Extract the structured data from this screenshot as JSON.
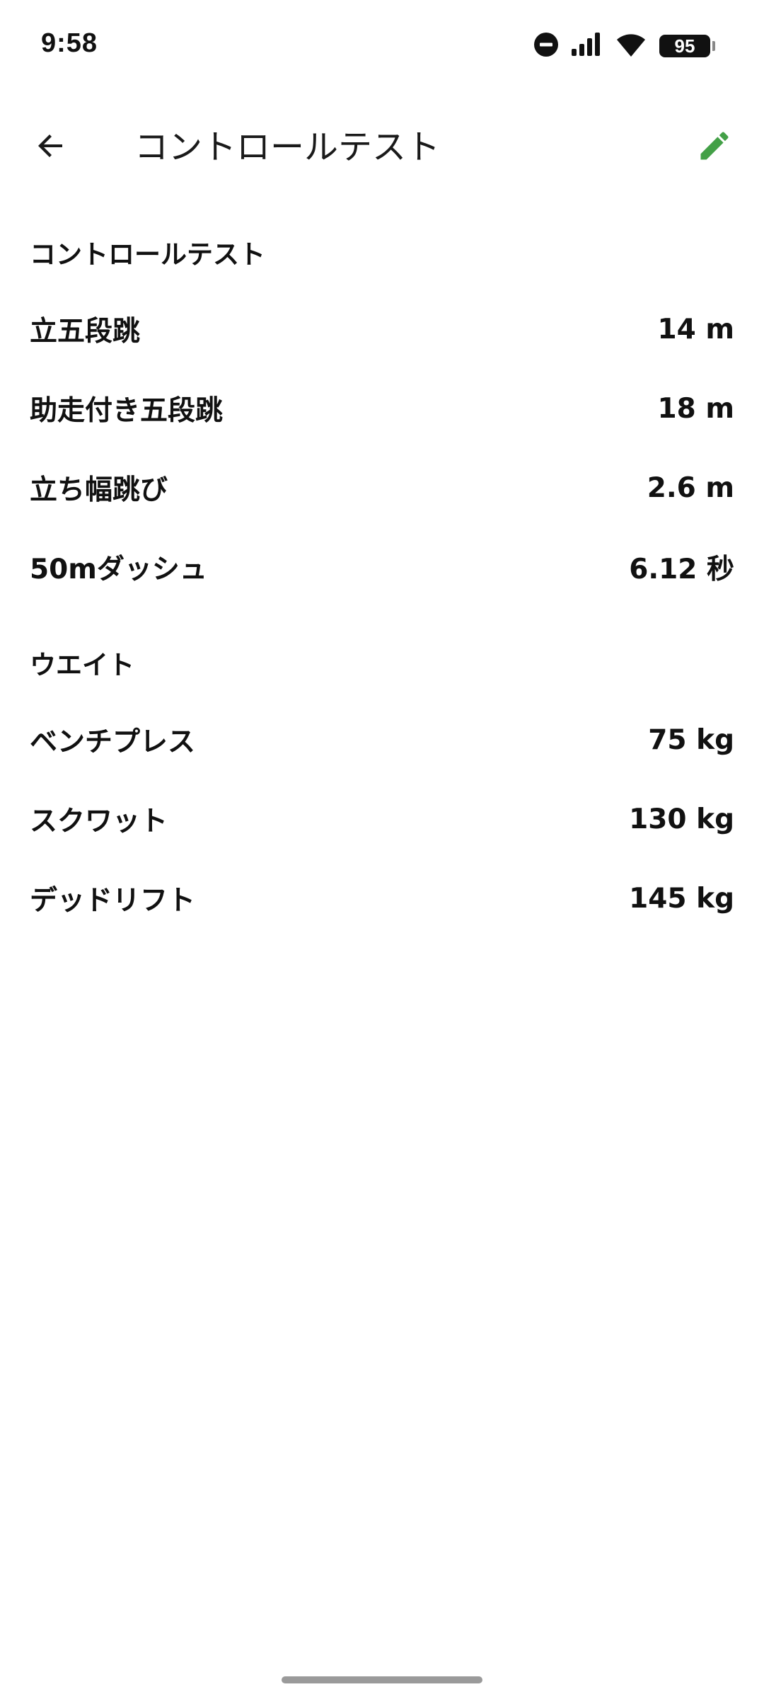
{
  "status_bar": {
    "time": "9:58",
    "battery_level": "95",
    "icons": [
      "do-not-disturb-icon",
      "signal-icon",
      "wifi-icon",
      "battery-icon"
    ]
  },
  "app_bar": {
    "title": "コントロールテスト",
    "back_icon": "arrow-left-icon",
    "edit_icon": "pencil-icon",
    "accent_color": "#43A047"
  },
  "sections": [
    {
      "title": "コントロールテスト",
      "items": [
        {
          "label": "立五段跳",
          "value": "14 m"
        },
        {
          "label": "助走付き五段跳",
          "value": "18 m"
        },
        {
          "label": "立ち幅跳び",
          "value": "2.6 m"
        },
        {
          "label": "50mダッシュ",
          "value": "6.12 秒"
        }
      ]
    },
    {
      "title": "ウエイト",
      "items": [
        {
          "label": "ベンチプレス",
          "value": "75 kg"
        },
        {
          "label": "スクワット",
          "value": "130 kg"
        },
        {
          "label": "デッドリフト",
          "value": "145 kg"
        }
      ]
    }
  ]
}
